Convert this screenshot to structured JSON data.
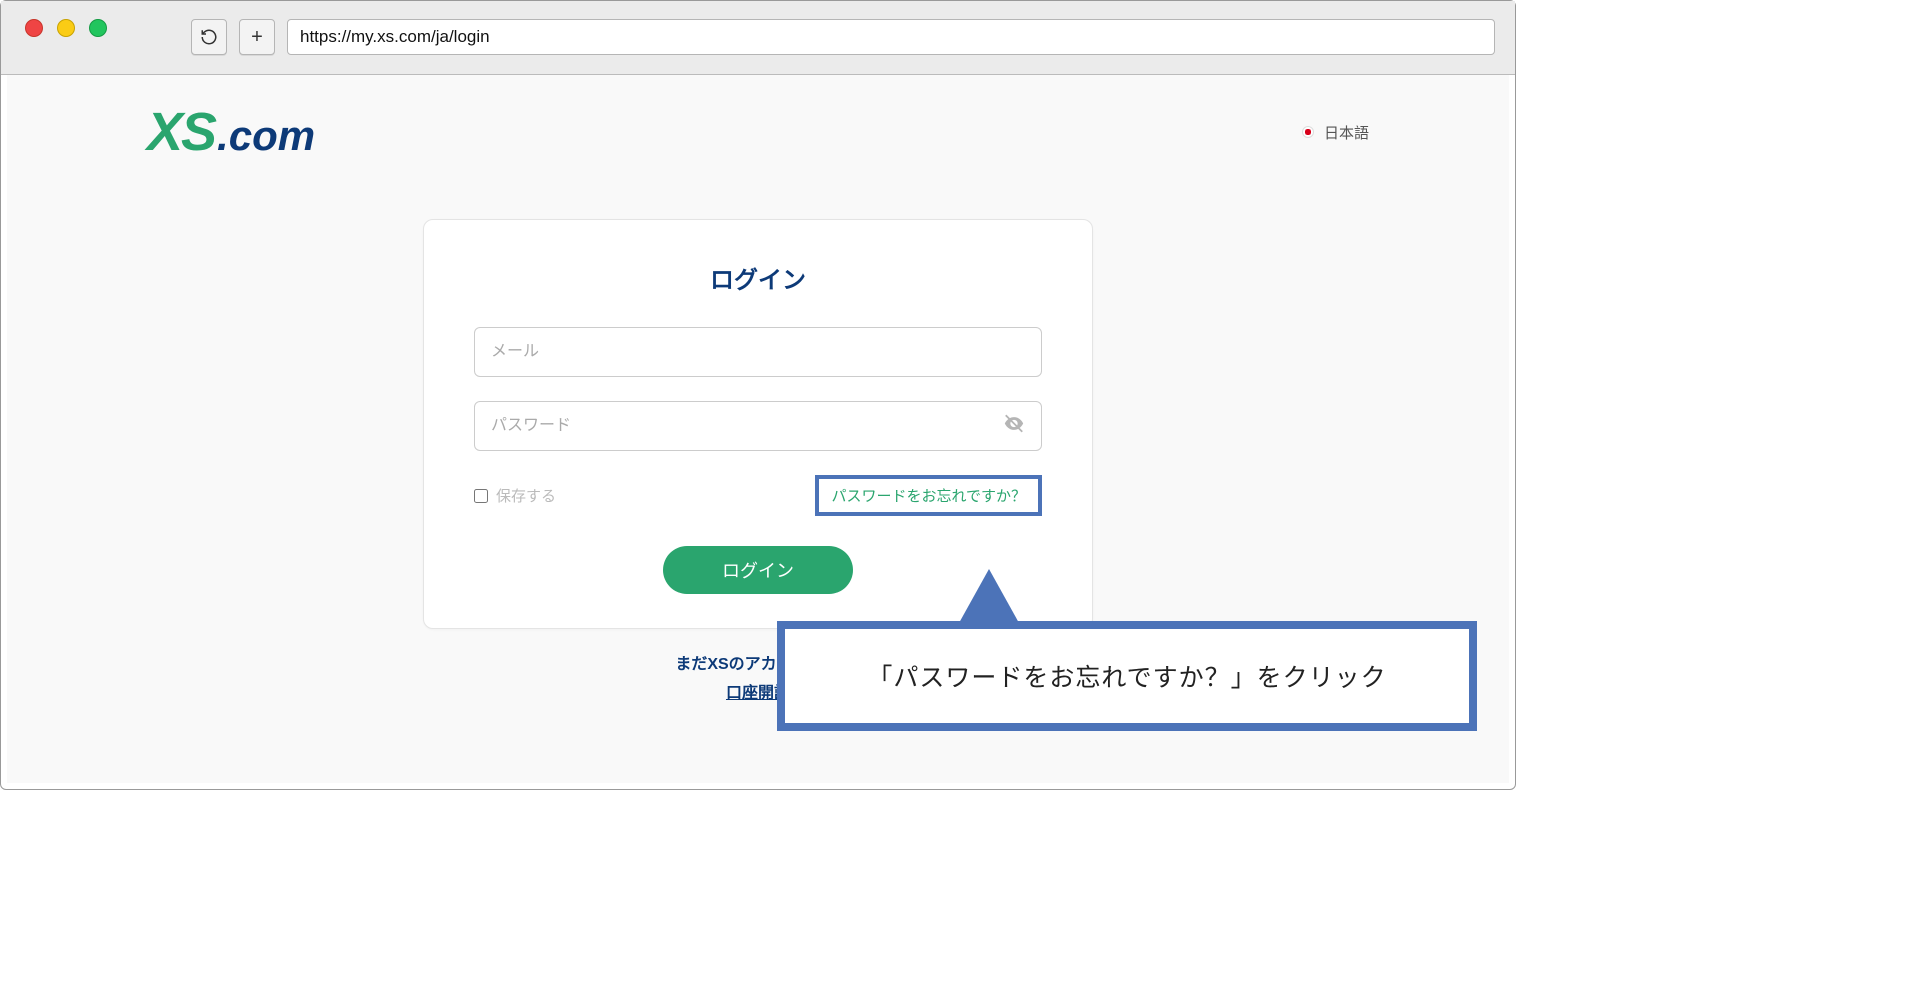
{
  "browser": {
    "url": "https://my.xs.com/ja/login"
  },
  "header": {
    "logo_xs": "XS",
    "logo_com": ".com",
    "language_label": "日本語"
  },
  "login": {
    "title": "ログイン",
    "email_placeholder": "メール",
    "password_placeholder": "パスワード",
    "remember_label": "保存する",
    "forgot_link": "パスワードをお忘れですか？",
    "submit_label": "ログイン"
  },
  "below": {
    "line1": "まだXSのアカウントを",
    "line2": "口座開設"
  },
  "callout": {
    "text": "「パスワードをお忘れですか？」をクリック"
  }
}
